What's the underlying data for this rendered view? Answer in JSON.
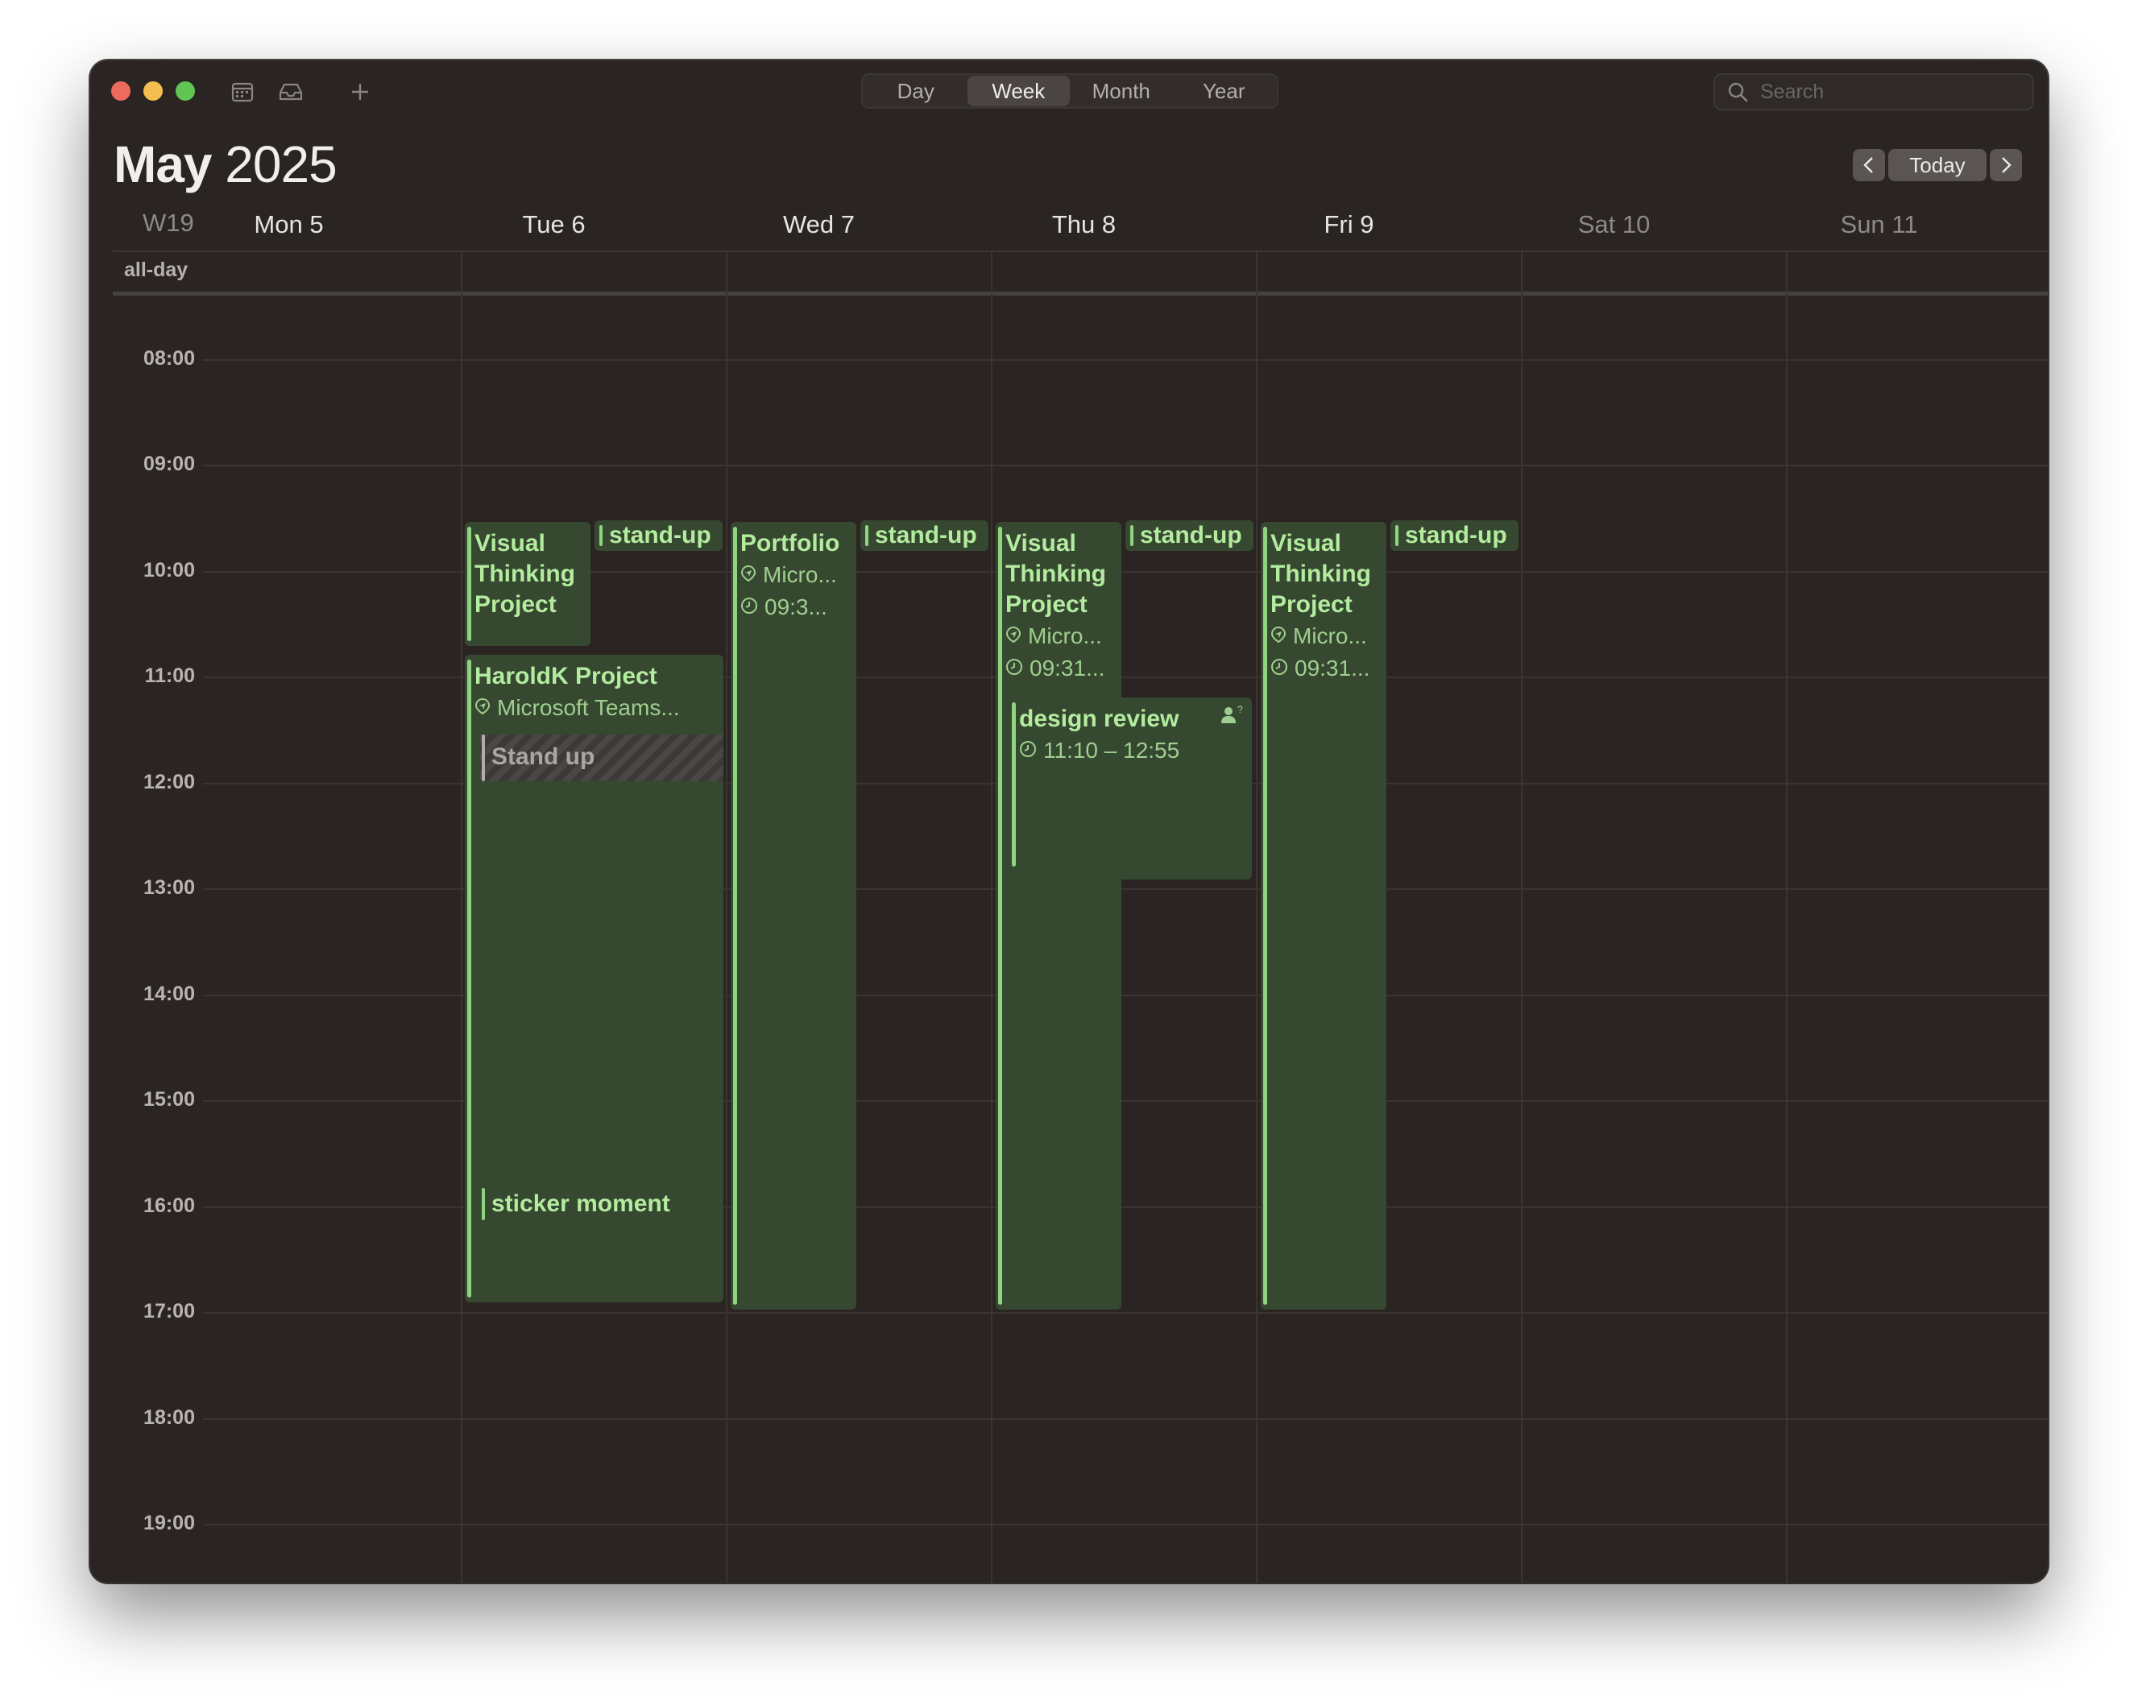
{
  "toolbar": {
    "views": [
      "Day",
      "Week",
      "Month",
      "Year"
    ],
    "active_view": "Week",
    "search_placeholder": "Search"
  },
  "header": {
    "month": "May",
    "year": "2025",
    "today_label": "Today",
    "week_label": "W19"
  },
  "days": [
    {
      "label": "Mon 5",
      "weekend": false
    },
    {
      "label": "Tue 6",
      "weekend": false
    },
    {
      "label": "Wed 7",
      "weekend": false
    },
    {
      "label": "Thu 8",
      "weekend": false
    },
    {
      "label": "Fri 9",
      "weekend": false
    },
    {
      "label": "Sat 10",
      "weekend": true
    },
    {
      "label": "Sun 11",
      "weekend": true
    }
  ],
  "allday_label": "all-day",
  "hours": [
    "08:00",
    "09:00",
    "10:00",
    "11:00",
    "12:00",
    "13:00",
    "14:00",
    "15:00",
    "16:00",
    "17:00",
    "18:00",
    "19:00"
  ],
  "events": {
    "tue_visual": {
      "title": "Visual Thinking Project"
    },
    "tue_standup": {
      "title": "stand-up"
    },
    "tue_harold": {
      "title": "HaroldK Project",
      "location": "Microsoft Teams..."
    },
    "tue_standup2": {
      "title": "Stand up"
    },
    "tue_sticker": {
      "title": "sticker moment"
    },
    "wed_portfolio": {
      "title": "Portfolio",
      "location": "Micro...",
      "time": "09:3..."
    },
    "wed_standup": {
      "title": "stand-up"
    },
    "thu_visual": {
      "title": "Visual Thinking Project",
      "location": "Micro...",
      "time": "09:31..."
    },
    "thu_standup": {
      "title": "stand-up"
    },
    "thu_design": {
      "title": "design review",
      "time": "11:10 – 12:55"
    },
    "fri_visual": {
      "title": "Visual Thinking Project",
      "location": "Micro...",
      "time": "09:31..."
    },
    "fri_standup": {
      "title": "stand-up"
    }
  },
  "icons": {
    "close": "traffic-close",
    "minimize": "traffic-minimize",
    "maximize": "traffic-maximize",
    "calendars": "calendar-list-icon",
    "inbox": "inbox-icon",
    "add": "plus-icon",
    "search": "search-icon",
    "location": "location-icon",
    "clock": "clock-icon",
    "invitee": "person-question-icon"
  },
  "colors": {
    "window_bg": "#2a2523",
    "event_bg": "#364830",
    "event_text": "#b3ec9f",
    "event_bar": "#8fd47f"
  }
}
